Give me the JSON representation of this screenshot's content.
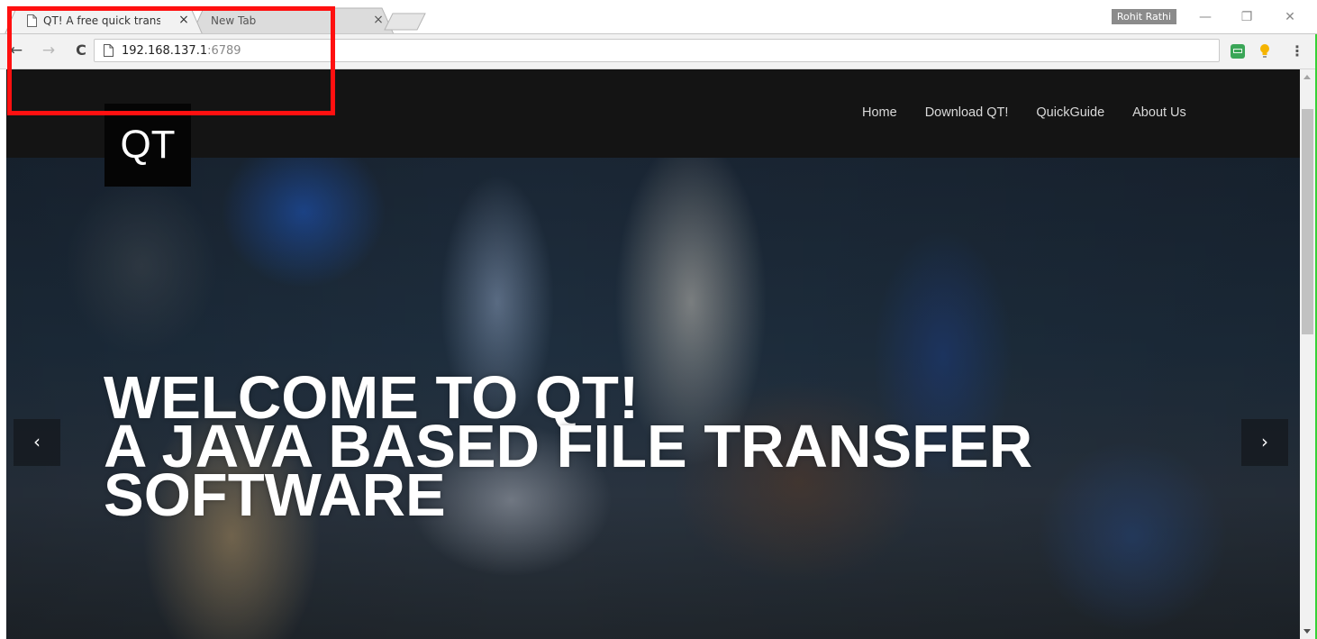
{
  "browser": {
    "tabs": [
      {
        "title": "QT! A free quick transfer",
        "active": true
      },
      {
        "title": "New Tab",
        "active": false
      }
    ],
    "profile_name": "Rohit Rathi",
    "url_host": "192.168.137.1",
    "url_port": ":6789",
    "icons": {
      "back": "←",
      "forward": "→",
      "reload": "C",
      "tab_close": "×",
      "minimize": "—",
      "maximize": "❐",
      "close": "✕",
      "menu": "⋮"
    },
    "colors": {
      "highlight": "#ff1010",
      "extension_green": "#3aa657"
    }
  },
  "site": {
    "logo": "QT",
    "nav": [
      "Home",
      "Download QT!",
      "QuickGuide",
      "About Us"
    ],
    "hero": {
      "lines": [
        "WELCOME TO QT!",
        "A JAVA BASED FILE TRANSFER",
        "SOFTWARE"
      ]
    },
    "carousel": {
      "prev": "‹",
      "next": "›"
    }
  }
}
